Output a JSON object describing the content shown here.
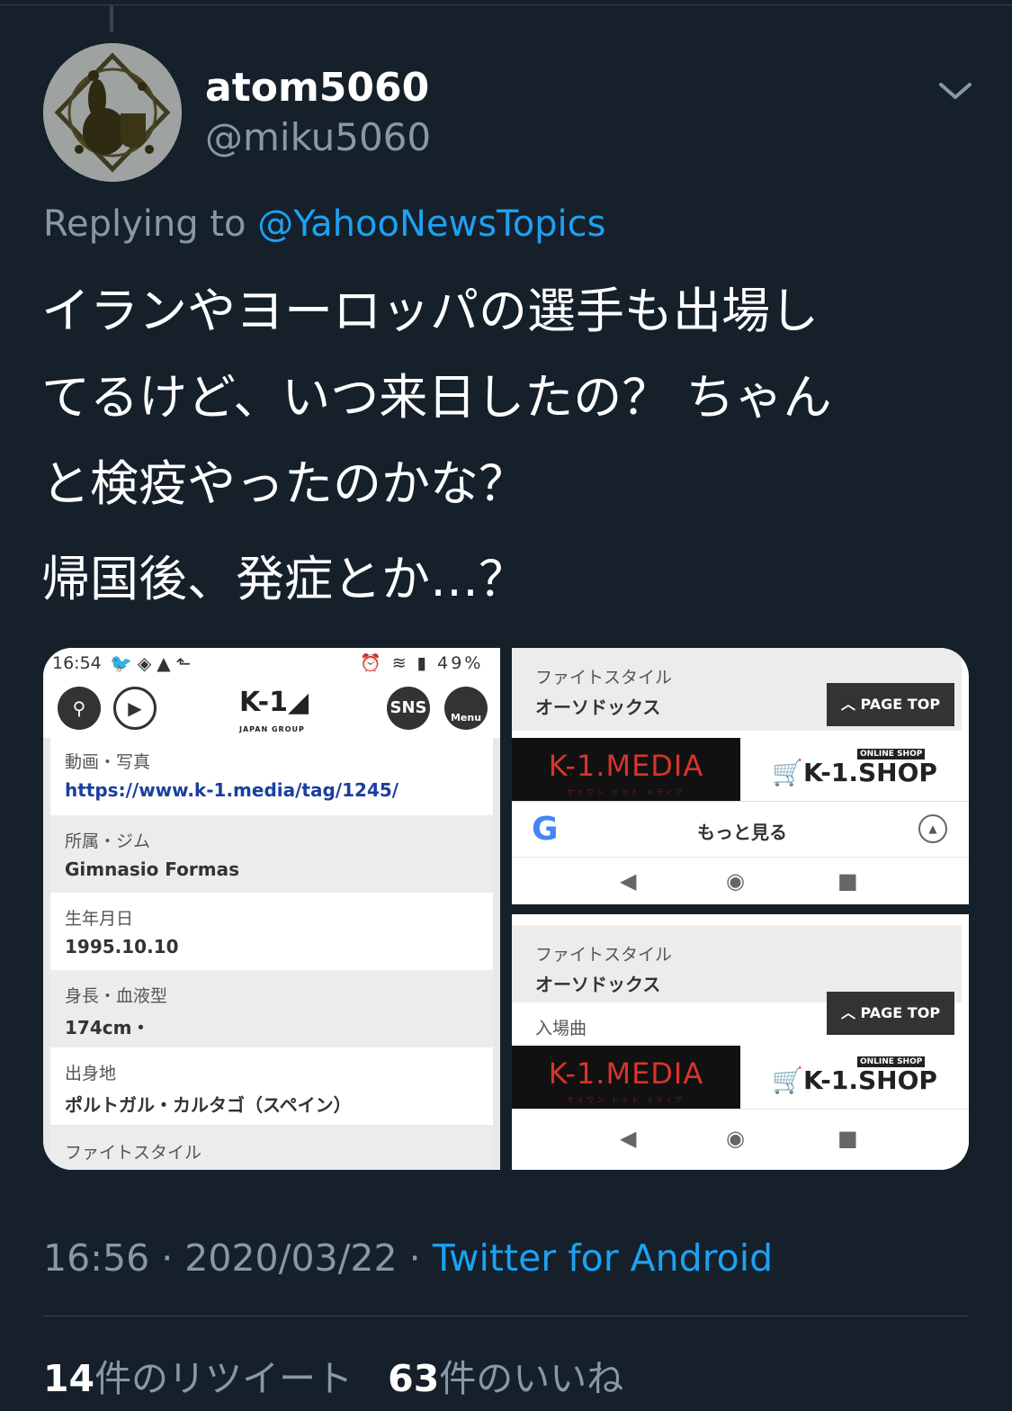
{
  "tweet": {
    "name": "atom5060",
    "handle": "@miku5060",
    "reply_prefix": "Replying to",
    "reply_to": "@YahooNewsTopics",
    "text_para1": "イランやヨーロッパの選手も出場し\nてるけど、いつ来日したの？ ちゃん\nと検疫やったのかな？",
    "text_para2": "帰国後、発症とか…？",
    "time": "16:56",
    "date": "2020/03/22",
    "separator": "·",
    "source": "Twitter for Android",
    "retweets_count": "14",
    "retweets_label": "件のリツイート",
    "likes_count": "63",
    "likes_label": "件のいいね"
  },
  "screenshot_left": {
    "status_time": "16:54",
    "status_battery": "49%",
    "sns_label": "SNS",
    "menu_label": "Menu",
    "logo": "K-1",
    "logo_sub": "JAPAN GROUP",
    "rows": [
      {
        "label": "動画・写真",
        "value": "https://www.k-1.media/tag/1245/"
      },
      {
        "label": "所属・ジム",
        "value": "Gimnasio Formas"
      },
      {
        "label": "生年月日",
        "value": "1995.10.10"
      },
      {
        "label": "身長・血液型",
        "value": "174cm・"
      },
      {
        "label": "出身地",
        "value": "ポルトガル・カルタゴ（スペイン）"
      },
      {
        "label": "ファイトスタイル",
        "value": ""
      }
    ]
  },
  "screenshot_right": {
    "fight_style_label": "ファイトスタイル",
    "fight_style_value": "オーソドックス",
    "page_top": "PAGE TOP",
    "media_banner": "K-1.MEDIA",
    "media_banner_sub": "ケイワン ドット メディア",
    "shop_banner": "K-1.SHOP",
    "shop_banner_sub": "ONLINE SHOP",
    "google_more": "もっと見る",
    "entry_label": "入場曲"
  },
  "colors": {
    "background": "#15202b",
    "link": "#1da1f2",
    "muted": "#8899a6"
  }
}
